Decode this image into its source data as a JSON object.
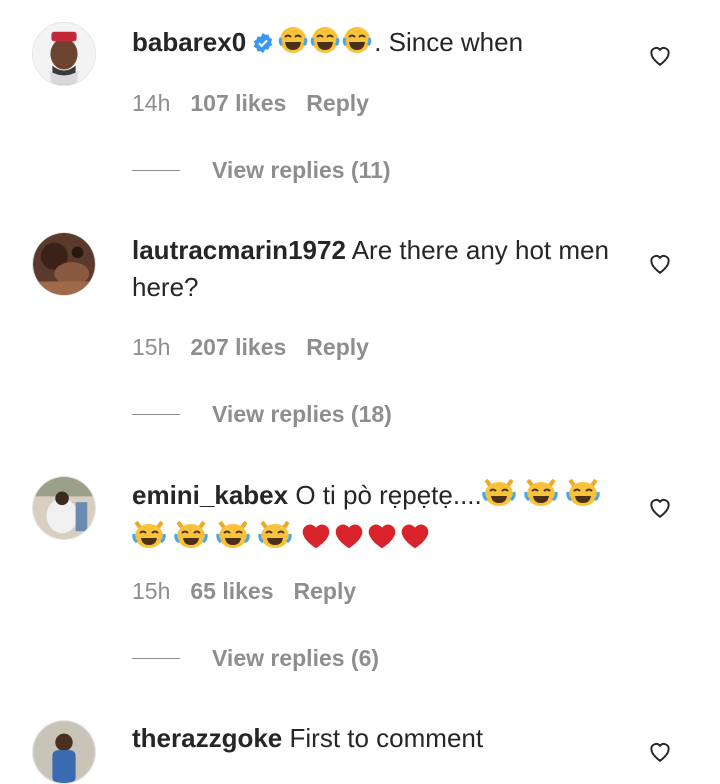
{
  "comments": [
    {
      "username": "babarex0",
      "verified": true,
      "emojis": [
        "face-with-tears-of-joy",
        "face-with-tears-of-joy",
        "face-with-tears-of-joy"
      ],
      "text": ". Since when",
      "time": "14h",
      "likes": "107 likes",
      "reply": "Reply",
      "view_replies": "View replies (11)"
    },
    {
      "username": "lautracmarin1972",
      "text": "Are there any hot men here?",
      "time": "15h",
      "likes": "207 likes",
      "reply": "Reply",
      "view_replies": "View replies (18)"
    },
    {
      "username": "emini_kabex",
      "text": "O ti pò rẹpẹtẹ....",
      "emojis": [
        "cat-with-tears-of-joy",
        "cat-with-tears-of-joy",
        "cat-with-tears-of-joy",
        "cat-with-tears-of-joy",
        "cat-with-tears-of-joy",
        "cat-with-tears-of-joy",
        "cat-with-tears-of-joy",
        "red-heart",
        "red-heart",
        "red-heart",
        "red-heart"
      ],
      "time": "15h",
      "likes": "65 likes",
      "reply": "Reply",
      "view_replies": "View replies (6)"
    },
    {
      "username": "therazzgoke",
      "text": "First to comment"
    }
  ]
}
